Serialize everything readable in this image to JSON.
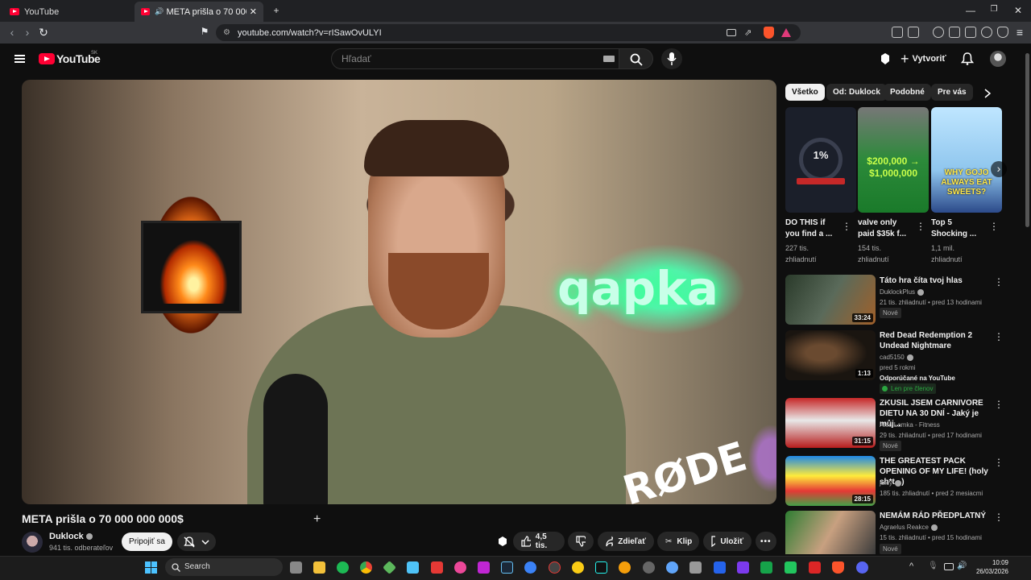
{
  "browser": {
    "tabs": [
      {
        "label": "YouTube"
      },
      {
        "label": "META prišla o 70 000 000 000$"
      }
    ],
    "url": "youtube.com/watch?v=rISawOvULYI"
  },
  "header": {
    "logo_text": "YouTube",
    "region": "SK",
    "search_placeholder": "Hľadať",
    "create_label": "Vytvoriť"
  },
  "video": {
    "title": "META prišla o 70 000 000 000$",
    "scene_neon": "qapka",
    "scene_brand": "RØDE",
    "channel": "Duklock",
    "subscribers": "941 tis. odberateľov",
    "join_label": "Pripojiť sa",
    "likes": "4,5 tis.",
    "share_label": "Zdieľať",
    "clip_label": "Klip",
    "save_label": "Uložiť"
  },
  "chips": [
    "Všetko",
    "Od: Duklock",
    "Podobné",
    "Pre vás"
  ],
  "shorts": [
    {
      "title": "DO THIS if you find a ...",
      "views": "227 tis. zhliadnutí",
      "thumb_text": "1%"
    },
    {
      "title": "valve only paid $35k f...",
      "views": "154 tis. zhliadnutí",
      "thumb_text": "$200,000 → $1,000,000"
    },
    {
      "title": "Top 5 Shocking ...",
      "views": "1,1 mil. zhliadnutí",
      "thumb_text": "WHY GOJO ALWAYS EAT SWEETS?"
    }
  ],
  "recommendations": [
    {
      "title": "Táto hra číta tvoj hlas",
      "channel": "DuklockPlus",
      "meta": "21 tis. zhliadnutí • pred 13 hodinami",
      "badge": "Nové",
      "duration": "33:24"
    },
    {
      "title": "Red Dead Redemption 2 Undead Nightmare",
      "channel": "cad5150",
      "meta": "pred 5 rokmi",
      "extra": "Odporúčané na YouTube",
      "badge": "Len pre členov",
      "duration": "1:13"
    },
    {
      "title": "ZKUSIL JSEM CARNIVORE DIETU NA 30 DNÍ - Jaký je můj...",
      "channel": "Aleš Lamka - Fitness",
      "meta": "29 tis. zhliadnutí • pred 17 hodinami",
      "badge": "Nové",
      "duration": "31:15"
    },
    {
      "title": "THE GREATEST PACK OPENING OF MY LIFE! (holy sh*t...)",
      "channel": "juicy",
      "meta": "185 tis. zhliadnutí • pred 2 mesiacmi",
      "duration": "28:15"
    },
    {
      "title": "NEMÁM RÁD PŘEDPLATNÝ",
      "channel": "Agraelus Reakce",
      "meta": "15 tis. zhliadnutí • pred 15 hodinami",
      "badge": "Nové",
      "duration": "28:20"
    }
  ],
  "taskbar": {
    "search_label": "Search",
    "time": "10:09",
    "date": "26/03/2026"
  },
  "colors": {
    "brand_red": "#ff0033",
    "bg": "#0f0f0f",
    "chip_bg": "#272727"
  }
}
